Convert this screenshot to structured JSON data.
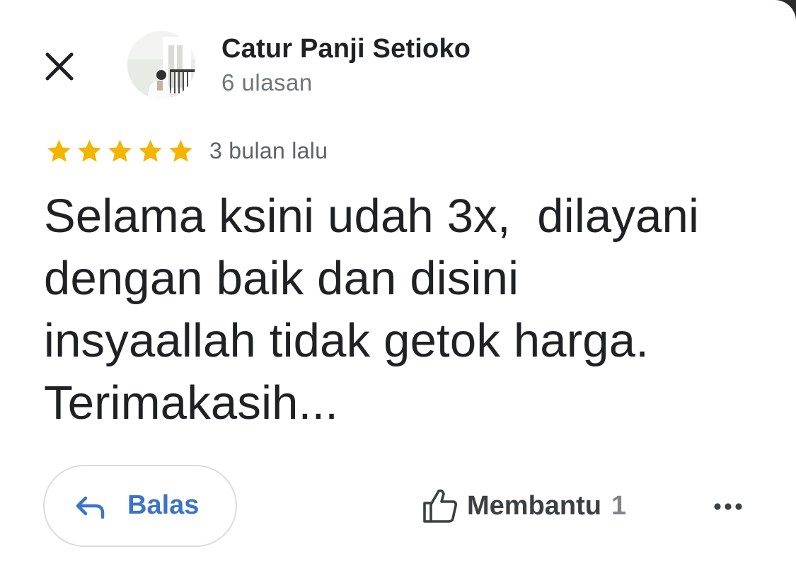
{
  "review": {
    "author": {
      "name": "Catur Panji Setioko",
      "review_count": "6 ulasan"
    },
    "rating": 5,
    "rating_max": 5,
    "time": "3 bulan lalu",
    "text": "Selama ksini udah 3x,  dilayani\ndengan baik dan disini\ninsyaallah tidak getok harga.\nTerimakasih..."
  },
  "actions": {
    "reply_label": "Balas",
    "helpful_label": "Membantu",
    "helpful_count": "1"
  },
  "icons": {
    "close": "close-icon",
    "avatar": "avatar",
    "star": "star-icon",
    "reply": "reply-arrow-icon",
    "thumb": "thumbs-up-icon",
    "more": "more-horizontal-icon"
  },
  "colors": {
    "star": "#f4b400",
    "accent": "#3c73c9",
    "text_primary": "#202124",
    "text_secondary": "#70757a"
  }
}
